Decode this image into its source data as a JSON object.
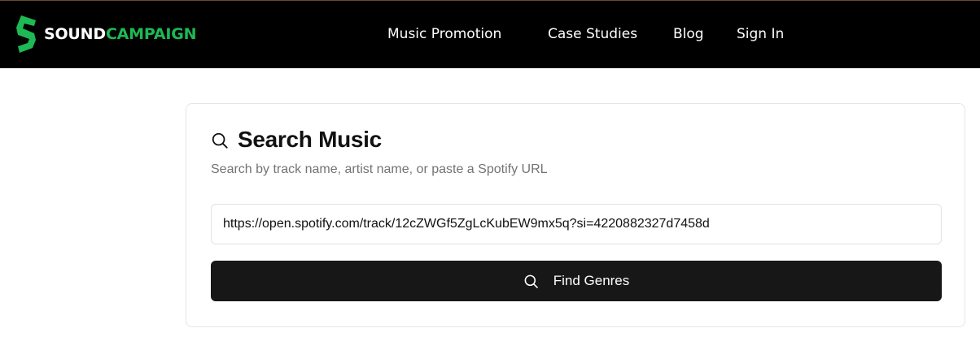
{
  "header": {
    "logo": {
      "part1": "SOUND",
      "part2": "CAMPAIGN",
      "part1_color": "#ffffff",
      "part2_color": "#1db954"
    },
    "nav": [
      {
        "label": "Music Promotion"
      },
      {
        "label": "Case Studies"
      },
      {
        "label": "Blog"
      },
      {
        "label": "Sign In"
      }
    ],
    "background": "#000000"
  },
  "search": {
    "icon": "search-icon",
    "title": "Search Music",
    "subtitle": "Search by track name, artist name, or paste a Spotify URL",
    "input_value": "https://open.spotify.com/track/12cZWGf5ZgLcKubEW9mx5q?si=4220882327d7458d",
    "button_label": "Find Genres",
    "button_icon": "search-icon",
    "button_color": "#171717"
  }
}
